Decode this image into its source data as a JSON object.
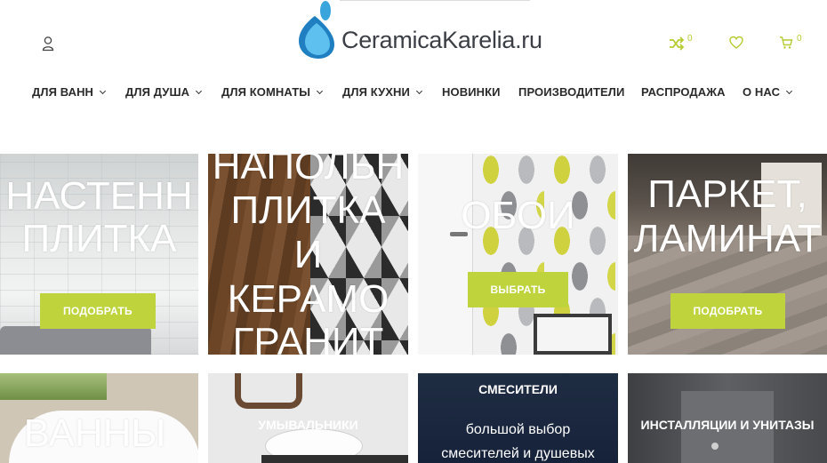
{
  "brand": {
    "name": "CeramicaKarelia.ru",
    "accent_color": "#bfd33c",
    "drop_color": "#3aa5dd"
  },
  "header": {
    "user_icon": "user-icon",
    "compare_icon": "shuffle-icon",
    "compare_count": "0",
    "wishlist_icon": "heart-icon",
    "cart_icon": "cart-icon",
    "cart_count": "0"
  },
  "menu": [
    {
      "label": "ДЛЯ ВАНН",
      "has_dropdown": true
    },
    {
      "label": "ДЛЯ ДУША",
      "has_dropdown": true
    },
    {
      "label": "ДЛЯ КОМНАТЫ",
      "has_dropdown": true
    },
    {
      "label": "ДЛЯ КУХНИ",
      "has_dropdown": true
    },
    {
      "label": "НОВИНКИ",
      "has_dropdown": false
    },
    {
      "label": "ПРОИЗВОДИТЕЛИ",
      "has_dropdown": false
    },
    {
      "label": "РАСПРОДАЖА",
      "has_dropdown": false
    },
    {
      "label": "О НАС",
      "has_dropdown": true
    }
  ],
  "tiles": [
    {
      "line1": "НАСТЕНН",
      "line2": "ПЛИТКА",
      "button": "ПОДОБРАТЬ"
    },
    {
      "line1": "НАПОЛЬН",
      "line2": "ПЛИТКА",
      "line3": "И",
      "line4": "КЕРАМО",
      "line5": "ГРАНИТ"
    },
    {
      "line1": "ОБОИ",
      "button": "ВЫБРАТЬ"
    },
    {
      "line1": "ПАРКЕТ,",
      "line2": "ЛАМИНАТ",
      "button": "ПОДОБРАТЬ"
    },
    {
      "line1": "ВАННЫ"
    },
    {
      "caption": "УМЫВАЛЬНИКИ"
    },
    {
      "caption": "СМЕСИТЕЛИ",
      "sub1": "большой выбор",
      "sub2": "смесителей и душевых"
    },
    {
      "caption": "ИНСТАЛЛЯЦИИ И УНИТАЗЫ"
    }
  ]
}
